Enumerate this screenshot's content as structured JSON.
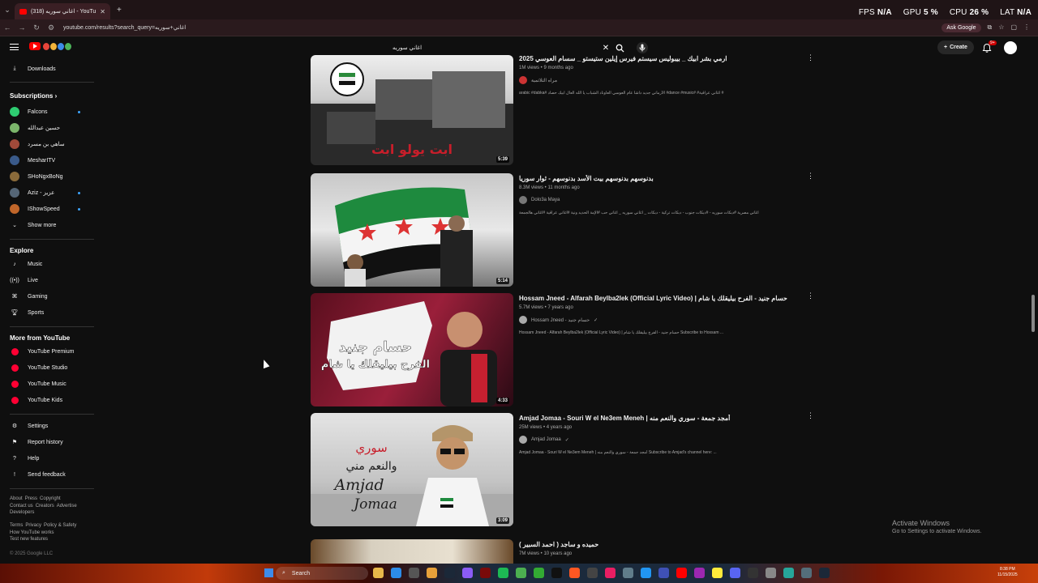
{
  "browser": {
    "tab_title": "(318) اغاني سوريه - YouTube",
    "url": "youtube.com/results?search_query=اغاني+سوريه",
    "ask_google": "Ask Google"
  },
  "overlay": {
    "fps_label": "FPS",
    "fps_value": "N/A",
    "gpu_label": "GPU",
    "gpu_value": "5 %",
    "cpu_label": "CPU",
    "cpu_value": "26 %",
    "lat_label": "LAT",
    "lat_value": "N/A"
  },
  "header": {
    "search_query": "اغاني سوريه",
    "create_label": "Create",
    "notif_badge": "9+"
  },
  "sidebar": {
    "downloads": "Downloads",
    "subscriptions_heading": "Subscriptions",
    "subscriptions": [
      {
        "label": "Falcons",
        "color": "#2ecc71"
      },
      {
        "label": "حسين عبدالله",
        "color": "#7cb56b"
      },
      {
        "label": "ساهي بن مسرد",
        "color": "#a04a3a"
      },
      {
        "label": "MesharITV",
        "color": "#3a5a8a"
      },
      {
        "label": "SHoNgxBoNg",
        "color": "#8a6a3a"
      },
      {
        "label": "Aziz - عزيز",
        "color": "#556677"
      },
      {
        "label": "IShowSpeed",
        "color": "#c0662a"
      }
    ],
    "show_more": "Show more",
    "explore_heading": "Explore",
    "explore": [
      "Music",
      "Live",
      "Gaming",
      "Sports"
    ],
    "more_heading": "More from YouTube",
    "more": [
      "YouTube Premium",
      "YouTube Studio",
      "YouTube Music",
      "YouTube Kids"
    ],
    "settings": [
      "Settings",
      "Report history",
      "Help",
      "Send feedback"
    ],
    "footer1": [
      "About",
      "Press",
      "Copyright",
      "Contact us",
      "Creators",
      "Advertise",
      "Developers"
    ],
    "footer2": [
      "Terms",
      "Privacy",
      "Policy & Safety",
      "How YouTube works",
      "Test new features"
    ],
    "copyright": "© 2025 Google LLC"
  },
  "results": [
    {
      "title": "ارمي بشر ابيك _ بيبوليس سيستم فيرس إيلين ستيستو _ سسام العوسي 2025",
      "views": "1M views • 9 months ago",
      "channel": "مراه الثلاثمية",
      "description": "arabic #dabka# الأرماني جديد داشا عام العوسي العاوناد الشباب يا الله العال ابيك حصاد #dance #music# #اغاني عراقية #",
      "duration": "5:39"
    },
    {
      "title": "بدنوسهم بدنوسهم بيت الأسد بدنوسهم - ثوار سوريا",
      "views": "8.3M views • 11 months ago",
      "channel": "Dolo3a Maya",
      "description": "اغاني مصرية #دبكات سوريه - #دبكات جنوب - دبكات تركية - دبكات _ اغاني سوريه _ اغاني حب #الإمة الحديد ونية #اغاني عراقية #اغاني هالجمعة",
      "duration": "5:14"
    },
    {
      "title": "Hossam Jneed - Alfarah Beylba2lek (Official Lyric Video) | حسام جنيد - الفرح بيليقلك يا شام",
      "views": "5.7M views • 7 years ago",
      "channel": "Hossam Jneed - حسام جنيد",
      "description": "Hossam Jneed - Alfarah Beylba2lek (Official Lyric Video) | حسام جنيد - الفرح بيليقلك يا شام Subscribe to Hossam ...",
      "duration": "4:33",
      "thumb_text_1": "حسام جنيد",
      "thumb_text_2": "الفرح بيليقلك يا شام"
    },
    {
      "title": "Amjad Jomaa - Souri W el Ne3em Meneh | أمجد جمعة - سوري والنعم منه",
      "views": "25M views • 4 years ago",
      "channel": "Amjad Jomaa",
      "description": "Amjad Jomaa - Souri W el Ne3em Meneh | أمجد جمعة - سوري والنعم منه Subscribe to Amjad's channel here: ...",
      "duration": "3:09",
      "thumb_text_1": "سوري",
      "thumb_text_2": "والنعم مني",
      "thumb_text_3": "Amjad",
      "thumb_text_4": "Jomaa"
    },
    {
      "title": "حميده و ساجد ( احمد السبير )",
      "views": "7M views • 10 years ago"
    }
  ],
  "thumb1_text": "ابت يولو ابت",
  "windows": {
    "activate_title": "Activate Windows",
    "activate_sub": "Go to Settings to activate Windows.",
    "search": "Search",
    "time": "8:38 PM",
    "date": "11/15/2025"
  }
}
